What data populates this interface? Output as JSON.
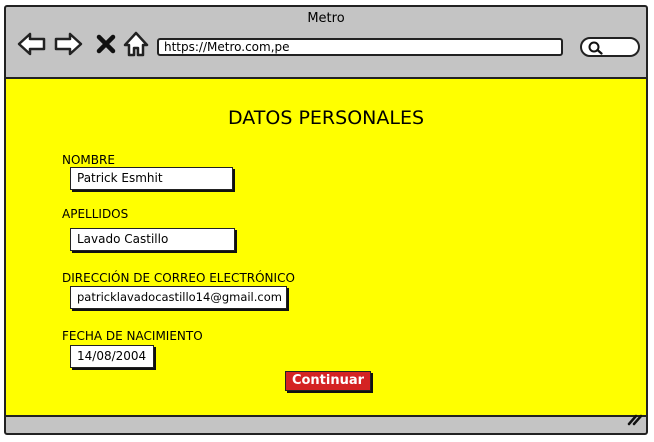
{
  "window": {
    "title": "Metro"
  },
  "toolbar": {
    "back_icon": "arrow-left-icon",
    "forward_icon": "arrow-right-icon",
    "stop_icon": "close-icon",
    "home_icon": "home-icon",
    "address": "https://Metro.com,pe",
    "search_icon": "search-icon"
  },
  "form": {
    "heading": "DATOS PERSONALES",
    "nombre_label": "NOMBRE",
    "nombre_value": "Patrick Esmhit",
    "apellidos_label": "APELLIDOS",
    "apellidos_value": "Lavado Castillo",
    "email_label": "DIRECCIÓN DE CORREO ELECTRÓNICO",
    "email_value": "patricklavadocastillo14@gmail.com",
    "fecha_label": "FECHA DE NACIMIENTO",
    "fecha_value": "14/08/2004",
    "continue_label": "Continuar"
  },
  "colors": {
    "page_background": "#ffff00",
    "chrome": "#c4c4c4",
    "button": "#d42323"
  }
}
